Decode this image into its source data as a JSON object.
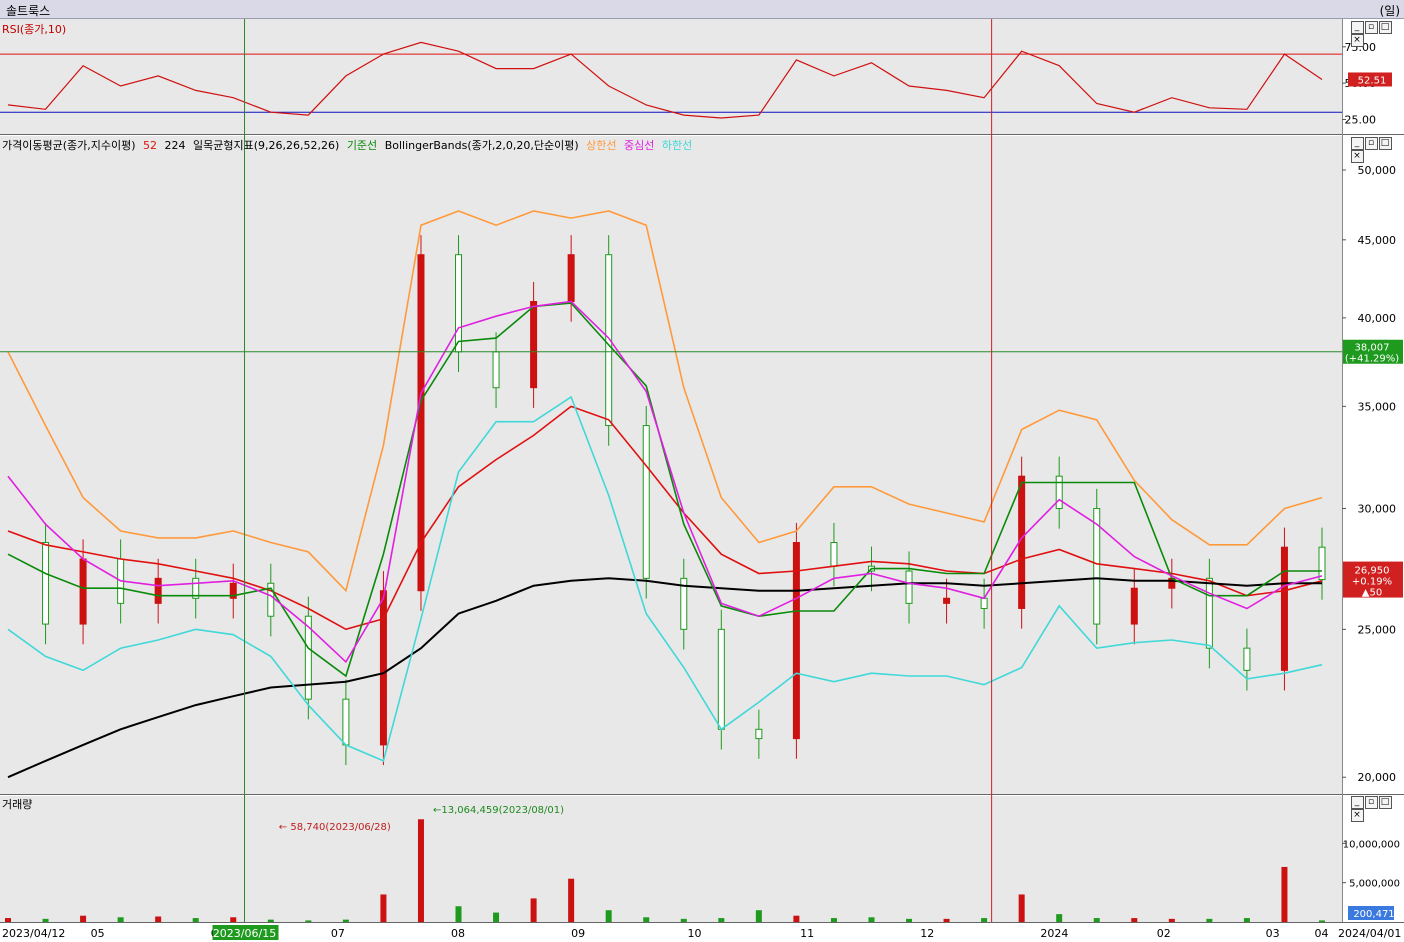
{
  "app": {
    "title": "솔트룩스",
    "period": "(일)"
  },
  "rsi": {
    "legend": "RSI(종가,10)",
    "ticks": [
      "75.00",
      "50.00",
      "25.00"
    ],
    "last": "52.51",
    "upper_line": 70,
    "lower_line": 30
  },
  "price": {
    "legend_ma": "가격이동평균(종가,지수이평)",
    "legend_ma_52": "52",
    "legend_ma_224": "224",
    "legend_ichimoku": "일목균형지표(9,26,26,52,26)",
    "legend_kijun": "기준선",
    "legend_bb": "BollingerBands(종가,2,0,20,단순이평)",
    "legend_bb_upper": "상한선",
    "legend_bb_mid": "중심선",
    "legend_bb_lower": "하한선",
    "ticks": [
      "50,000",
      "45,000",
      "40,000",
      "35,000",
      "30,000",
      "25,000",
      "20,000"
    ],
    "crosshair_value": "38,007",
    "crosshair_pct": "(+41.29%)",
    "last_price": "26,950",
    "last_pct": "+0.19%",
    "last_change": "▲50"
  },
  "volume": {
    "legend": "거래량",
    "ticks": [
      "10,000,000",
      "5,000,000"
    ],
    "max_label": "13,064,459(2023/08/01)",
    "min_label": "58,740(2023/06/28)",
    "last": "200,471"
  },
  "xaxis": {
    "labels": [
      "2023/04/12",
      "05",
      "06",
      "2023/06/15",
      "07",
      "08",
      "09",
      "10",
      "11",
      "12",
      "2024",
      "02",
      "03",
      "04",
      "2024/04/01"
    ]
  },
  "colors": {
    "up": "#cc1111",
    "down": "#1e9a1e",
    "ma52": "#e01010",
    "ma224": "#000000",
    "kijun": "#0a8a0a",
    "bb_upper": "#ff9a3c",
    "bb_mid": "#e020e0",
    "bb_lower": "#40d8d8",
    "rsi": "#d01010",
    "bg": "#e8e8e8"
  },
  "chart_data": {
    "type": "line",
    "title": "솔트룩스",
    "x": [
      "2023/04/12",
      "2023/04/20",
      "2023/05/01",
      "2023/05/10",
      "2023/05/20",
      "2023/06/01",
      "2023/06/10",
      "2023/06/20",
      "2023/07/01",
      "2023/07/10",
      "2023/07/20",
      "2023/08/01",
      "2023/08/10",
      "2023/08/20",
      "2023/09/01",
      "2023/09/10",
      "2023/09/20",
      "2023/10/01",
      "2023/10/10",
      "2023/10/20",
      "2023/11/01",
      "2023/11/10",
      "2023/11/20",
      "2023/12/01",
      "2023/12/10",
      "2023/12/20",
      "2024/01/01",
      "2024/01/10",
      "2024/01/20",
      "2024/02/01",
      "2024/02/10",
      "2024/02/20",
      "2024/03/01",
      "2024/03/10",
      "2024/03/20",
      "2024/04/01"
    ],
    "series": [
      {
        "name": "종가",
        "values": [
          28500,
          25200,
          27800,
          26000,
          27000,
          26200,
          26800,
          25500,
          22500,
          21000,
          26500,
          44000,
          38000,
          36000,
          41000,
          44000,
          34000,
          27000,
          25000,
          21500,
          21200,
          28500,
          27500,
          27300,
          26000,
          26200,
          25800,
          31500,
          30000,
          25200,
          26600,
          27000,
          24300,
          23500,
          28300,
          26950
        ]
      },
      {
        "name": "52",
        "values": [
          29000,
          28400,
          28100,
          27800,
          27600,
          27300,
          27000,
          26500,
          25800,
          25000,
          25400,
          28500,
          31000,
          32300,
          33500,
          35000,
          34300,
          32000,
          29800,
          28000,
          27200,
          27300,
          27500,
          27700,
          27600,
          27300,
          27200,
          27800,
          28200,
          27600,
          27400,
          27200,
          26900,
          26300,
          26500,
          26900
        ]
      },
      {
        "name": "224",
        "values": [
          20000,
          20500,
          21000,
          21500,
          21900,
          22300,
          22600,
          22900,
          23000,
          23100,
          23400,
          24300,
          25600,
          26100,
          26700,
          26900,
          27000,
          26900,
          26700,
          26600,
          26500,
          26500,
          26600,
          26700,
          26800,
          26800,
          26700,
          26800,
          26900,
          27000,
          26900,
          26900,
          26800,
          26700,
          26800,
          26800
        ]
      },
      {
        "name": "기준선",
        "values": [
          28000,
          27200,
          26600,
          26600,
          26300,
          26300,
          26300,
          26600,
          24300,
          23300,
          28000,
          35300,
          38600,
          38800,
          40700,
          40900,
          38400,
          36100,
          29300,
          25900,
          25500,
          25700,
          25700,
          27400,
          27400,
          27200,
          27200,
          31200,
          31200,
          31200,
          31200,
          27000,
          26300,
          26300,
          27300,
          27300
        ]
      },
      {
        "name": "상한선",
        "values": [
          38000,
          34000,
          30500,
          29000,
          28700,
          28700,
          29000,
          28500,
          28100,
          26500,
          33000,
          46000,
          47000,
          46000,
          47000,
          46500,
          47000,
          46000,
          36000,
          30500,
          28500,
          29000,
          31000,
          31000,
          30200,
          29800,
          29400,
          33800,
          34800,
          34300,
          31300,
          29500,
          28400,
          28400,
          30000,
          30500
        ]
      },
      {
        "name": "중심선",
        "values": [
          31500,
          29300,
          27800,
          26900,
          26700,
          26800,
          26900,
          26300,
          25100,
          23800,
          26200,
          35700,
          39400,
          40100,
          40700,
          41000,
          38800,
          35800,
          29800,
          26000,
          25500,
          26200,
          27000,
          27200,
          26800,
          26600,
          26200,
          28700,
          30400,
          29300,
          27900,
          27100,
          26400,
          25800,
          26700,
          27100
        ]
      },
      {
        "name": "하한선",
        "values": [
          25000,
          24000,
          23500,
          24300,
          24600,
          25000,
          24800,
          24000,
          22300,
          21000,
          20500,
          25400,
          31700,
          34200,
          34200,
          35500,
          30600,
          25600,
          23600,
          21500,
          22400,
          23400,
          23100,
          23400,
          23300,
          23300,
          23000,
          23600,
          25900,
          24300,
          24500,
          24600,
          24400,
          23200,
          23400,
          23700
        ]
      }
    ],
    "rsi": [
      35,
      32,
      62,
      48,
      55,
      45,
      40,
      30,
      28,
      55,
      70,
      78,
      72,
      60,
      60,
      70,
      48,
      35,
      28,
      26,
      28,
      66,
      55,
      64,
      48,
      45,
      40,
      72,
      62,
      36,
      30,
      40,
      33,
      32,
      70,
      52.51
    ],
    "volume_millions": [
      0.5,
      0.4,
      0.8,
      0.6,
      0.7,
      0.5,
      0.6,
      0.3,
      0.2,
      0.3,
      3.5,
      13.06,
      2.0,
      1.2,
      3.0,
      5.5,
      1.5,
      0.6,
      0.4,
      0.5,
      1.5,
      0.8,
      0.5,
      0.6,
      0.4,
      0.4,
      0.5,
      3.5,
      1.0,
      0.5,
      0.5,
      0.4,
      0.4,
      0.5,
      7.0,
      0.2
    ],
    "price_ylim": [
      19500,
      52000
    ],
    "price_scale": "log",
    "rsi_ylim": [
      15,
      90
    ],
    "volume_ylim": [
      0,
      15000000
    ],
    "grid": false,
    "legend_position": "top-left"
  }
}
